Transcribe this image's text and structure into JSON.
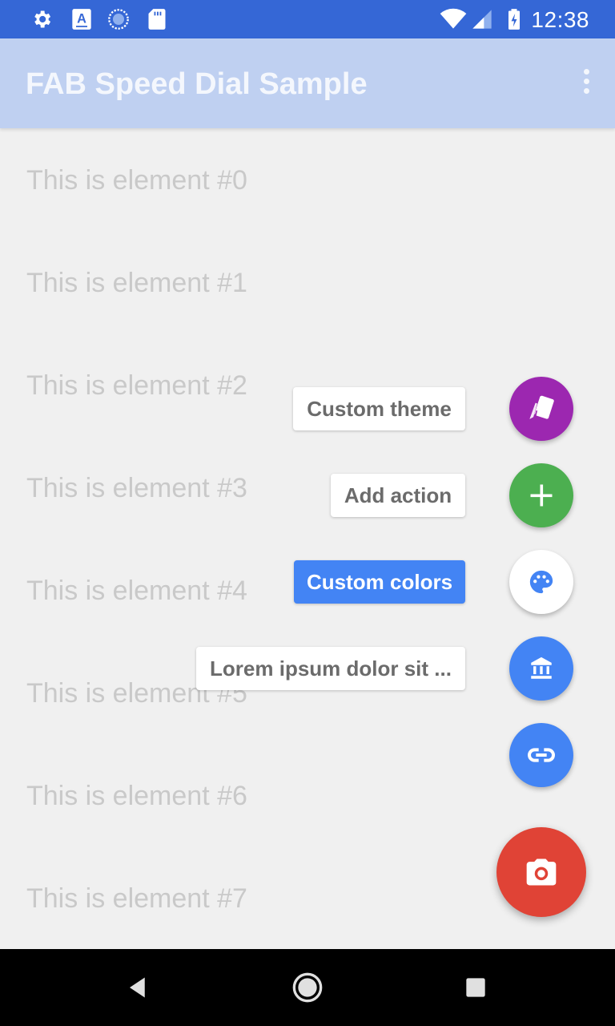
{
  "status_bar": {
    "time": "12:38",
    "left_icons": [
      "settings-icon",
      "a-badge-icon",
      "sync-icon",
      "sd-card-icon"
    ],
    "right_icons": [
      "wifi-icon",
      "signal-icon",
      "battery-charging-icon"
    ],
    "background": "#3567d6"
  },
  "app_bar": {
    "title": "FAB Speed Dial Sample",
    "background": "#bfd0f1",
    "overflow_icon": "more-vert-icon"
  },
  "list": {
    "items": [
      "This is element #0",
      "This is element #1",
      "This is element #2",
      "This is element #3",
      "This is element #4",
      "This is element #5",
      "This is element #6",
      "This is element #7"
    ]
  },
  "speed_dial": {
    "actions": [
      {
        "label": "Custom theme",
        "icon": "cards-icon",
        "color": "#9c27b0",
        "highlight": false
      },
      {
        "label": "Add action",
        "icon": "plus-icon",
        "color": "#4caf50",
        "highlight": false
      },
      {
        "label": "Custom colors",
        "icon": "palette-icon",
        "color": "#ffffff",
        "highlight": true
      },
      {
        "label": "Lorem ipsum dolor sit ...",
        "icon": "bank-icon",
        "color": "#4384f4",
        "highlight": false
      },
      {
        "label": "",
        "icon": "link-icon",
        "color": "#4384f4",
        "highlight": false
      }
    ],
    "main_fab": {
      "icon": "camera-icon",
      "color": "#e04336"
    }
  },
  "nav_bar": {
    "buttons": [
      "back-icon",
      "home-icon",
      "recents-icon"
    ]
  }
}
